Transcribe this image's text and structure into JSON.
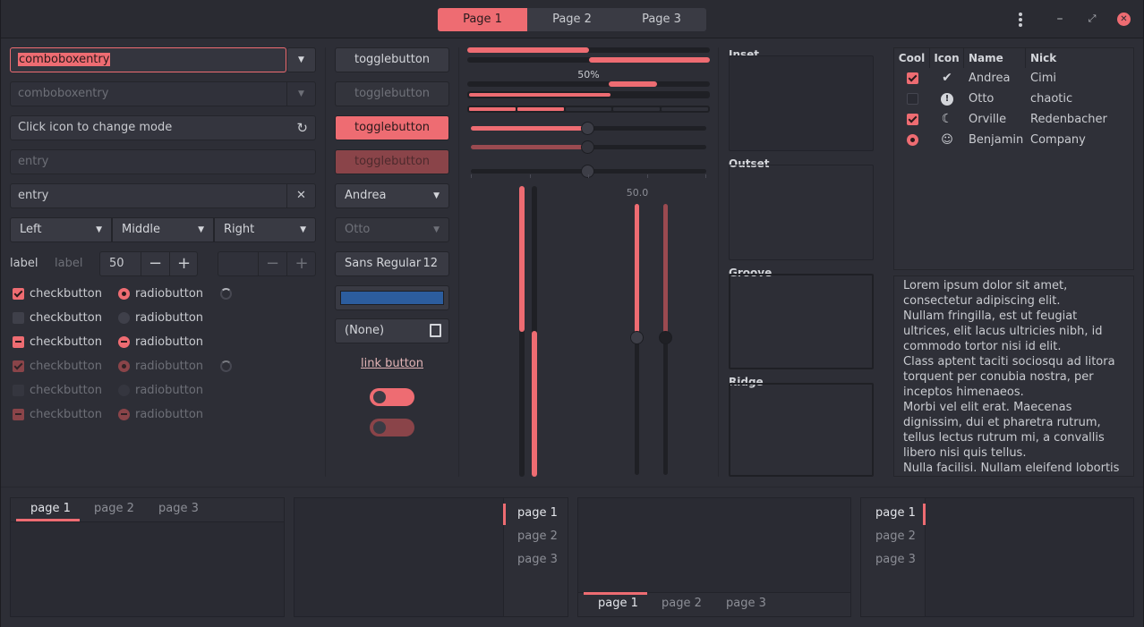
{
  "header": {
    "stack_pages": [
      "Page 1",
      "Page 2",
      "Page 3"
    ],
    "menu_icon": "vertical-dots-icon",
    "minimize": "–",
    "maximize": "⤢",
    "close": "✕"
  },
  "col1": {
    "combo_entry": "comboboxentry",
    "combo_entry_disabled": "comboboxentry",
    "icon_entry": "Click icon to change mode",
    "entry_placeholder": "entry",
    "entry_clear": "entry",
    "combo_left": "Left",
    "combo_middle": "Middle",
    "combo_right": "Right",
    "label1": "label",
    "label2": "label",
    "spin_value": "50",
    "spin_minus": "−",
    "spin_plus": "+",
    "check_label": "checkbutton",
    "radio_label": "radiobutton"
  },
  "col2": {
    "toggle": "togglebutton",
    "combo_andrea": "Andrea",
    "combo_otto": "Otto",
    "font_name": "Sans Regular",
    "font_size": "12",
    "color_value": "#2c5d9e",
    "file_none": "(None)",
    "link": "link button",
    "switches": [
      true,
      true
    ]
  },
  "col3": {
    "progress_label": "50%",
    "progress": 0.5,
    "scale_label": "50.0",
    "scale_value": 50
  },
  "frames": [
    "Inset",
    "Outset",
    "Groove",
    "Ridge"
  ],
  "tree": {
    "headers": [
      "Cool",
      "Icon",
      "Name",
      "Nick"
    ],
    "rows": [
      {
        "cool": "checked",
        "icon": "check-circle-icon",
        "name": "Andrea",
        "nick": "Cimi"
      },
      {
        "cool": "unchecked",
        "icon": "warning-icon",
        "name": "Otto",
        "nick": "chaotic"
      },
      {
        "cool": "checked",
        "icon": "moon-icon",
        "name": "Orville",
        "nick": "Redenbacher"
      },
      {
        "cool": "radio",
        "icon": "face-icon",
        "name": "Benjamin",
        "nick": "Company"
      }
    ]
  },
  "textview": "Lorem ipsum dolor sit amet, consectetur adipiscing elit.\nNullam fringilla, est ut feugiat ultrices, elit lacus ultricies nibh, id commodo tortor nisi id elit.\nClass aptent taciti sociosqu ad litora torquent per conubia nostra, per inceptos himenaeos.\nMorbi vel elit erat. Maecenas dignissim, dui et pharetra rutrum, tellus lectus rutrum mi, a convallis libero nisi quis tellus.\nNulla facilisi. Nullam eleifend lobortis",
  "notebook_tabs": [
    "page 1",
    "page 2",
    "page 3"
  ],
  "colors": {
    "accent": "#ee6c72",
    "bg": "#2d2e36"
  }
}
